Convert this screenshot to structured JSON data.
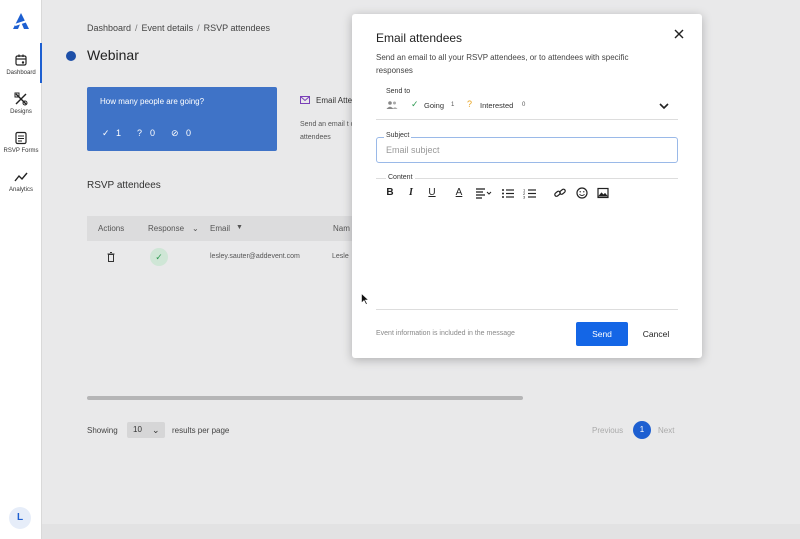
{
  "sidebar": {
    "items": [
      {
        "label": "Dashboard",
        "icon": "calendar-icon"
      },
      {
        "label": "Designs",
        "icon": "designs-icon"
      },
      {
        "label": "RSVP Forms",
        "icon": "rsvp-forms-icon"
      },
      {
        "label": "Analytics",
        "icon": "analytics-icon"
      }
    ],
    "avatar_initial": "L"
  },
  "breadcrumb": {
    "items": [
      "Dashboard",
      "Event details",
      "RSVP attendees"
    ],
    "separator": "/"
  },
  "page": {
    "title": "Webinar",
    "going_card": {
      "question": "How many people are going?",
      "going": "1",
      "interested": "0",
      "declined": "0"
    },
    "email_card": {
      "title": "Email Atte",
      "body": "Send an email t or to attendees"
    },
    "section_title": "RSVP attendees",
    "table": {
      "headers": [
        "Actions",
        "Response",
        "Email",
        "Nam"
      ],
      "rows": [
        {
          "email": "lesley.sauter@addevent.com",
          "name": "Lesle"
        }
      ]
    },
    "pagination": {
      "showing": "Showing",
      "per_page": "10",
      "results_label": "results per page",
      "previous": "Previous",
      "current": "1",
      "next": "Next"
    }
  },
  "modal": {
    "title": "Email attendees",
    "description": "Send an email to all your RSVP attendees, or to attendees with specific responses",
    "send_to": {
      "label": "Send to",
      "going_label": "Going",
      "going_count": "1",
      "interested_label": "Interested",
      "interested_count": "0"
    },
    "subject": {
      "label": "Subject",
      "placeholder": "Email subject",
      "value": ""
    },
    "content": {
      "label": "Content"
    },
    "toolbar": [
      "bold",
      "italic",
      "underline",
      "text-color",
      "align",
      "bullet-list",
      "numbered-list",
      "link",
      "emoji",
      "image"
    ],
    "footer_note": "Event information is included in the message",
    "send_label": "Send",
    "cancel_label": "Cancel"
  },
  "colors": {
    "accent": "#1466e6",
    "card_blue": "#3f73c7",
    "going_green": "#2f9a52",
    "interested_orange": "#e8a21b",
    "declined_red": "#e04a4a"
  }
}
